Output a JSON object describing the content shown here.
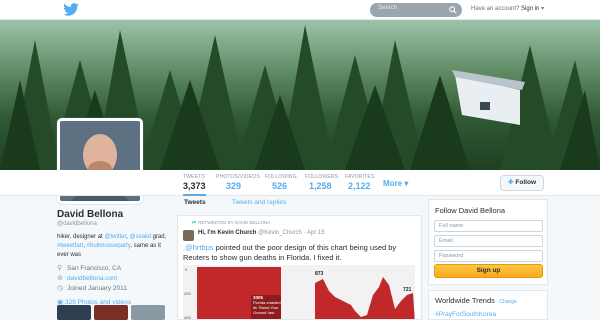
{
  "topbar": {
    "search_placeholder": "Search",
    "signin_prefix": "Have an account?",
    "signin_link": "Sign in",
    "signin_caret": "▾"
  },
  "nav": {
    "stats": [
      {
        "label": "TWEETS",
        "value": "3,373"
      },
      {
        "label": "PHOTOS/VIDEOS",
        "value": "329"
      },
      {
        "label": "FOLLOWING",
        "value": "526"
      },
      {
        "label": "FOLLOWERS",
        "value": "1,258"
      },
      {
        "label": "FAVORITES",
        "value": "2,122"
      }
    ],
    "more_label": "More ▾",
    "follow_label": "Follow"
  },
  "profile": {
    "name": "David Bellona",
    "handle": "@davidbellona",
    "bio_1": "hiker, designer at ",
    "bio_twitter": "@twitter",
    "bio_2": ", ",
    "bio_svaiid": "@svaiid",
    "bio_3": " grad,",
    "bio_tweetfart": "#tweetfart",
    "bio_4": ", ",
    "bio_bullmoose": "#bullmooseparty",
    "bio_5": ", same as it ever was",
    "location": "San Francisco, CA",
    "website": "davidbellona.com",
    "joined": "Joined January 2011",
    "photos_label": "329 Photos and videos"
  },
  "timeline": {
    "tab_tweets": "Tweets",
    "tab_replies": "Tweets and replies",
    "tweet": {
      "retweet_label": "RETWEETED BY DAVID BELLONA",
      "author_name": "Hi, I'm Kevin Church",
      "author_meta": "@Kevin_Church · Apr 15",
      "mention": ".@hrtbps",
      "text": " pointed out the poor design of this chart being used by Reuters to show gun deaths in Florida. I fixed it.",
      "chart": {
        "tick_0": "0",
        "tick_200": "200",
        "tick_400": "400",
        "peak_label": "873",
        "end_label": "721",
        "ann_year": "2005",
        "ann_text_1": "Florida enacted",
        "ann_text_2": "its 'Stand Your",
        "ann_text_3": "Ground' law"
      }
    }
  },
  "follow_box": {
    "title": "Follow David Bellona",
    "fullname_placeholder": "Full name",
    "email_placeholder": "Email",
    "password_placeholder": "Password",
    "signup_label": "Sign up"
  },
  "trends": {
    "title": "Worldwide Trends",
    "change_label": " · Change",
    "items": [
      "#PrayForSouthKorea"
    ]
  },
  "colors": {
    "accent": "#55acee",
    "signup": "#fdbd39",
    "chart_red": "#c0282a"
  }
}
